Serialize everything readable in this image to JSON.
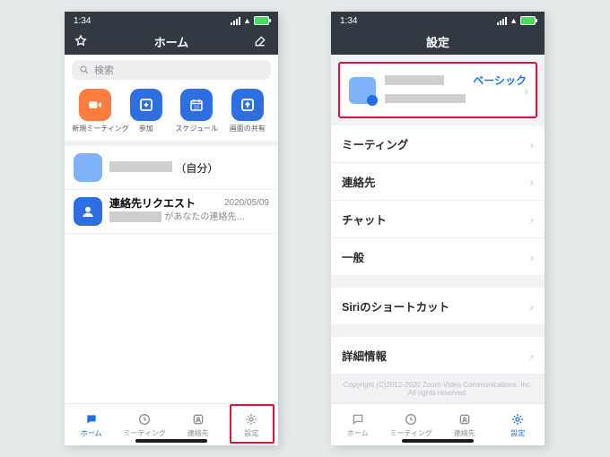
{
  "statusbar": {
    "time": "1:34"
  },
  "home": {
    "header": {
      "title": "ホーム"
    },
    "search": {
      "placeholder": "検索"
    },
    "actions": [
      {
        "label": "新規ミーティング"
      },
      {
        "label": "参加"
      },
      {
        "label": "スケジュール"
      },
      {
        "label": "画面の共有"
      }
    ],
    "self_row": {
      "suffix": "（自分）"
    },
    "request_row": {
      "title": "連絡先リクエスト",
      "date": "2020/05/09",
      "subtext": "があなたの連絡先…"
    },
    "tabs": {
      "home": "ホーム",
      "meetings": "ミーティング",
      "contacts": "連絡先",
      "settings": "設定"
    }
  },
  "settings": {
    "header": {
      "title": "設定"
    },
    "profile": {
      "plan_label": "ベーシック"
    },
    "items": {
      "meeting": "ミーティング",
      "contacts": "連絡先",
      "chat": "チャット",
      "general": "一般",
      "siri": "Siriのショートカット",
      "details": "詳細情報"
    },
    "copyright": "Copyright (C)2012-2020 Zoom Video Communications, Inc. All rights reserved.",
    "tabs": {
      "home": "ホーム",
      "meetings": "ミーティング",
      "contacts": "連絡先",
      "settings": "設定"
    }
  }
}
